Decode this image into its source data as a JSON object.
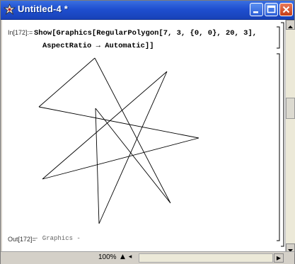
{
  "window": {
    "title": "Untitled-4 *",
    "colors": {
      "titlebar": "#1f4fd0",
      "close": "#c53d16"
    }
  },
  "cell": {
    "input_label": "In[172]:=",
    "code_line1": "Show[Graphics[RegularPolygon[7, 3, {0, 0}, 20, 3],",
    "code_line2": "AspectRatio → Automatic]]",
    "output_label": "Out[172]=",
    "output_value": "- Graphics -"
  },
  "statusbar": {
    "zoom": "100%",
    "zoom_arrows": "▲ ◂"
  },
  "icons": {
    "app": "mathematica-icon",
    "minimize": "minimize-icon",
    "maximize": "maximize-icon",
    "close": "close-icon"
  }
}
